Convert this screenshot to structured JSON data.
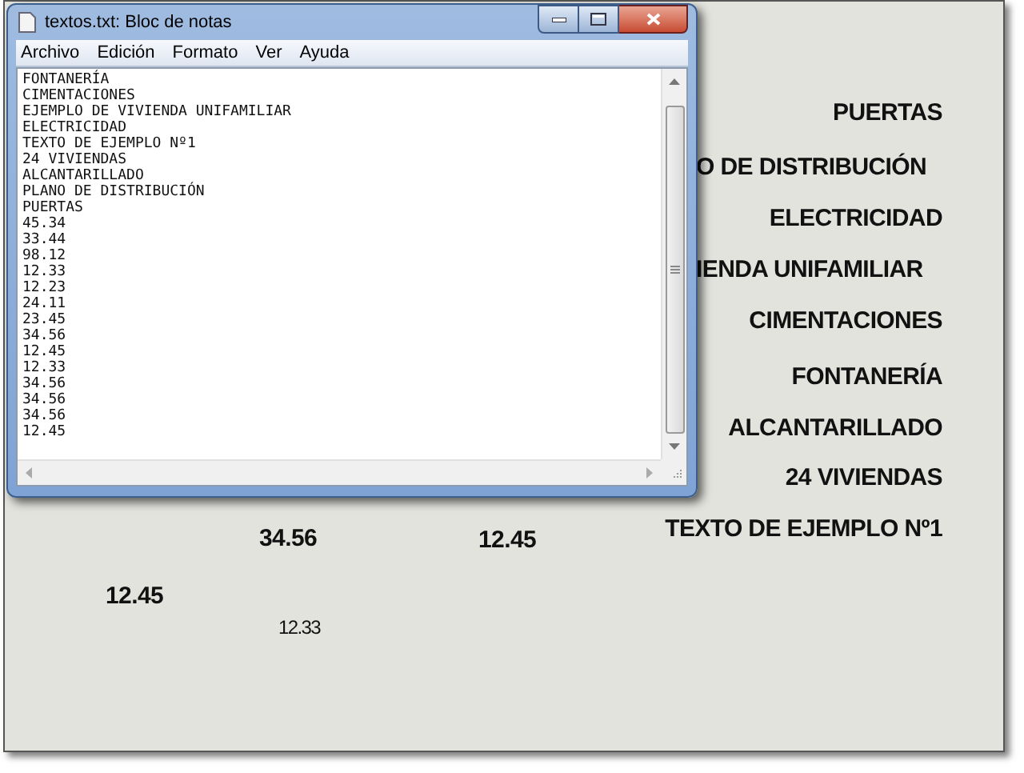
{
  "canvas": {
    "labels": [
      {
        "text": "PUERTAS",
        "kind": "title"
      },
      {
        "text": "O DE DISTRIBUCIÓN",
        "kind": "title"
      },
      {
        "text": "ELECTRICIDAD",
        "kind": "title"
      },
      {
        "text": "IENDA UNIFAMILIAR",
        "kind": "title"
      },
      {
        "text": "CIMENTACIONES",
        "kind": "title"
      },
      {
        "text": "FONTANERÍA",
        "kind": "title"
      },
      {
        "text": "ALCANTARILLADO",
        "kind": "title"
      },
      {
        "text": "24 VIVIENDAS",
        "kind": "title"
      },
      {
        "text": "TEXTO DE EJEMPLO Nº1",
        "kind": "title"
      },
      {
        "text": "34.56",
        "kind": "number"
      },
      {
        "text": "12.45",
        "kind": "number"
      },
      {
        "text": "12.45",
        "kind": "number"
      },
      {
        "text": "12.33",
        "kind": "small_number"
      }
    ]
  },
  "window": {
    "title": "textos.txt: Bloc de notas",
    "menu": [
      "Archivo",
      "Edición",
      "Formato",
      "Ver",
      "Ayuda"
    ],
    "lines": [
      "FONTANERÍA",
      "CIMENTACIONES",
      "EJEMPLO DE VIVIENDA UNIFAMILIAR",
      "ELECTRICIDAD",
      "TEXTO DE EJEMPLO Nº1",
      "24 VIVIENDAS",
      "ALCANTARILLADO",
      "PLANO DE DISTRIBUCIÓN",
      "PUERTAS",
      "45.34",
      "33.44",
      "98.12",
      "12.33",
      "12.23",
      "24.11",
      "23.45",
      "34.56",
      "12.45",
      "12.33",
      "34.56",
      "34.56",
      "34.56",
      "12.45"
    ]
  }
}
